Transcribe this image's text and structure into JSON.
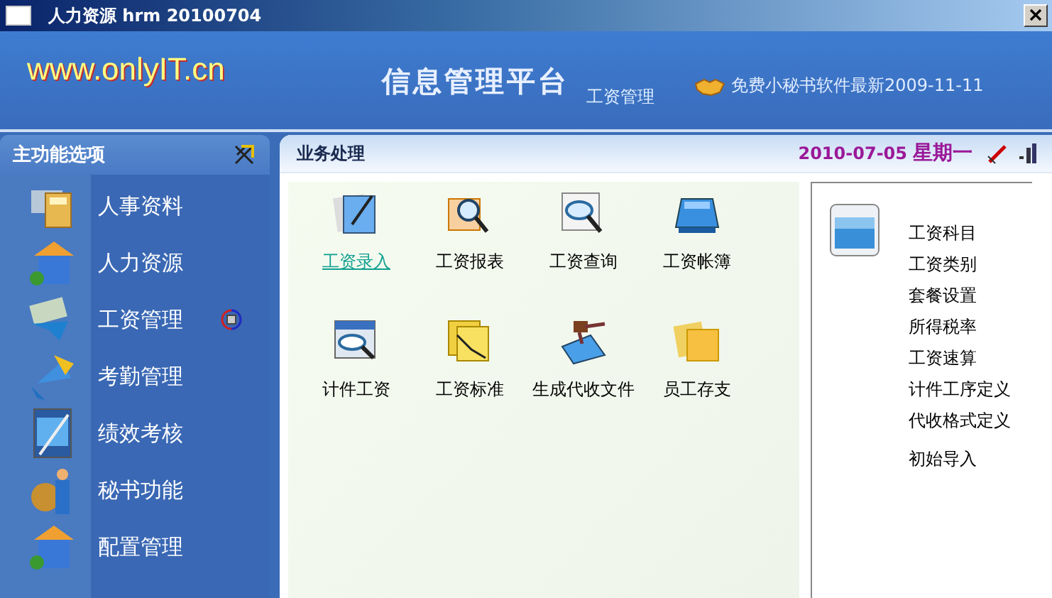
{
  "window": {
    "title": "人力资源 hrm 20100704"
  },
  "header": {
    "logo": "www.onlyIT.cn",
    "title": "信息管理平台",
    "subtitle": "工资管理",
    "notice": "免费小秘书软件最新2009-11-11"
  },
  "sidebar": {
    "title": "主功能选项",
    "items": [
      {
        "label": "人事资料",
        "selected": false
      },
      {
        "label": "人力资源",
        "selected": false
      },
      {
        "label": "工资管理",
        "selected": true
      },
      {
        "label": "考勤管理",
        "selected": false
      },
      {
        "label": "绩效考核",
        "selected": false
      },
      {
        "label": "秘书功能",
        "selected": false
      },
      {
        "label": "配置管理",
        "selected": false
      }
    ]
  },
  "panel": {
    "title": "业务处理",
    "date": "2010-07-05",
    "weekday": "星期一",
    "tasks": [
      {
        "label": "工资录入",
        "selected": true
      },
      {
        "label": "工资报表",
        "selected": false
      },
      {
        "label": "工资查询",
        "selected": false
      },
      {
        "label": "工资帐簿",
        "selected": false
      },
      {
        "label": "计件工资",
        "selected": false
      },
      {
        "label": "工资标准",
        "selected": false
      },
      {
        "label": "生成代收文件",
        "selected": false
      },
      {
        "label": "员工存支",
        "selected": false
      }
    ],
    "settings": [
      [
        "工资科目",
        "工资类别",
        "套餐设置",
        "所得税率",
        "工资速算",
        "计件工序定义",
        "代收格式定义"
      ],
      [
        "初始导入"
      ]
    ]
  }
}
